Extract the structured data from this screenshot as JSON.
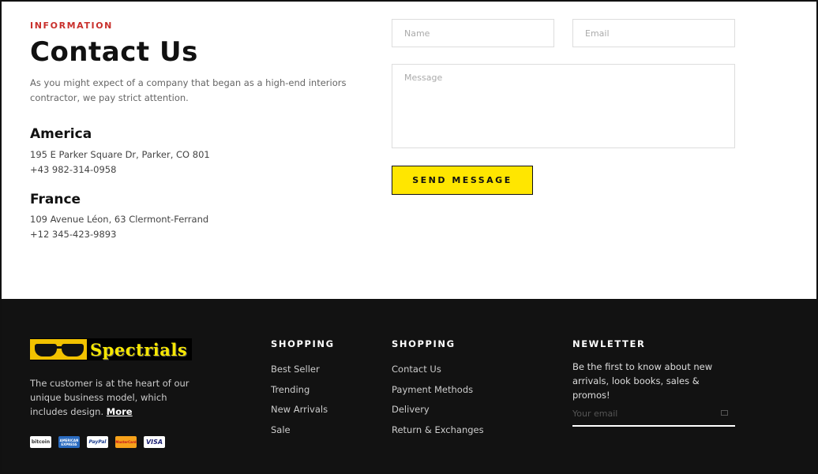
{
  "contact": {
    "eyebrow": "INFORMATION",
    "title": "Contact Us",
    "lead": "As you might expect of a company that began as a high-end interiors contractor, we pay strict attention.",
    "locations": [
      {
        "name": "America",
        "address": "195 E Parker Square Dr, Parker, CO 801",
        "phone": "+43 982-314-0958"
      },
      {
        "name": "France",
        "address": "109 Avenue Léon, 63 Clermont-Ferrand",
        "phone": "+12 345-423-9893"
      }
    ]
  },
  "form": {
    "name_placeholder": "Name",
    "email_placeholder": "Email",
    "message_placeholder": "Message",
    "send_label": "SEND MESSAGE"
  },
  "footer": {
    "logo_text": "Spectrials",
    "about_text": "The customer is at the heart of our unique business model, which includes design. ",
    "about_more": "More",
    "payments": [
      "bitcoin",
      "AMERICAN EXPRESS",
      "PayPal",
      "MasterCard",
      "VISA"
    ],
    "col1": {
      "title": "SHOPPING",
      "links": [
        "Best Seller",
        "Trending",
        "New Arrivals",
        "Sale"
      ]
    },
    "col2": {
      "title": "SHOPPING",
      "links": [
        "Contact Us",
        "Payment Methods",
        "Delivery",
        "Return & Exchanges"
      ]
    },
    "newsletter": {
      "title": "NEWLETTER",
      "text": "Be the first to know about new arrivals, look books, sales & promos!",
      "placeholder": "Your email"
    }
  },
  "colors": {
    "accent": "#ffe600",
    "eyebrow": "#c9302c",
    "footer_bg": "#121212"
  }
}
